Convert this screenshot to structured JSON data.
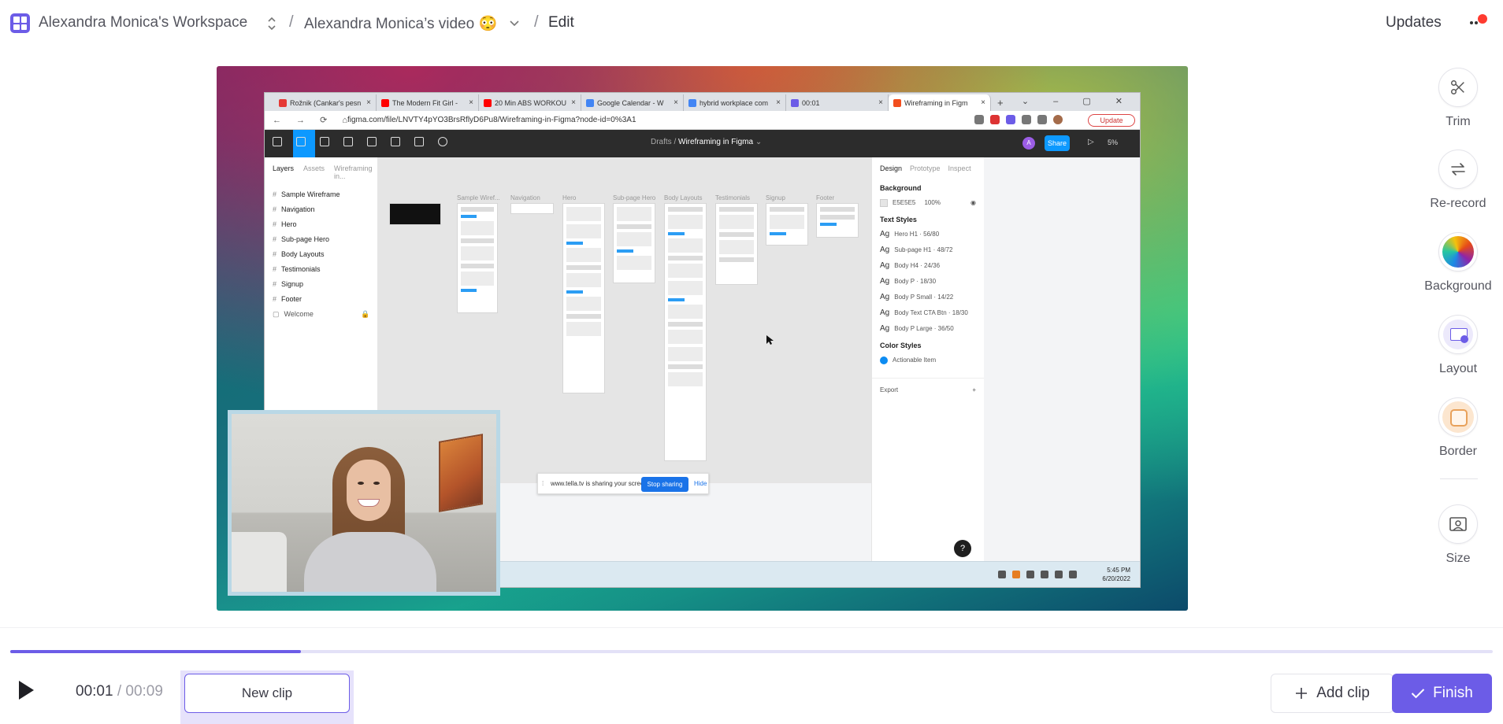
{
  "header": {
    "workspace_name": "Alexandra Monica's Workspace",
    "separator": "/",
    "video_name": "Alexandra Monica’s video 😳",
    "page": "Edit",
    "updates_label": "Updates"
  },
  "screen": {
    "browser_tabs": [
      {
        "label": "Rožnik (Cankar's pesn",
        "color": "#e53935"
      },
      {
        "label": "The Modern Fit Girl -",
        "color": "#ff0000"
      },
      {
        "label": "20 Min ABS WORKOU",
        "color": "#ff0000"
      },
      {
        "label": "Google Calendar - W",
        "color": "#4285f4"
      },
      {
        "label": "hybrid workplace com",
        "color": "#4285f4"
      },
      {
        "label": "00:01",
        "color": "#6c5ce7"
      },
      {
        "label": "Wireframing in Figm",
        "color": "#f24e1e"
      }
    ],
    "url": "figma.com/file/LNVTY4pYO3BrsRflyD6Pu8/Wireframing-in-Figma?node-id=0%3A1",
    "update_btn": "Update",
    "figma": {
      "breadcrumb_prefix": "Drafts /",
      "file_name": "Wireframing in Figma",
      "share_label": "Share",
      "avatar_letter": "A",
      "zoom": "5%",
      "layers_tabs": [
        "Layers",
        "Assets",
        "Wireframing in..."
      ],
      "layers": [
        "Sample Wireframe",
        "Navigation",
        "Hero",
        "Sub-page Hero",
        "Body Layouts",
        "Testimonials",
        "Signup",
        "Footer"
      ],
      "locked_layer": "Welcome",
      "frames": [
        "Sample Wiref...",
        "Navigation",
        "Hero",
        "Sub-page Hero",
        "Body Layouts",
        "Testimonials",
        "Signup",
        "Footer"
      ],
      "design_tabs": [
        "Design",
        "Prototype",
        "Inspect"
      ],
      "background_heading": "Background",
      "background_value": "E5E5E5",
      "background_opacity": "100%",
      "text_styles_heading": "Text Styles",
      "text_styles": [
        "Hero H1 · 56/80",
        "Sub-page H1 · 48/72",
        "Body H4 · 24/36",
        "Body P · 18/30",
        "Body P Small · 14/22",
        "Body Text CTA Btn · 18/30",
        "Body P Large · 36/50"
      ],
      "color_styles_heading": "Color Styles",
      "color_style": "Actionable Item",
      "export_label": "Export",
      "help": "?"
    },
    "share_notice": "www.tella.tv is sharing your screen.",
    "stop_sharing": "Stop sharing",
    "hide": "Hide",
    "clock_time": "5:45 PM",
    "clock_date": "6/20/2022"
  },
  "tools": [
    {
      "label": "Trim",
      "icon": "scissors-icon"
    },
    {
      "label": "Re-record",
      "icon": "re-record-icon"
    },
    {
      "label": "Background",
      "icon": "background-gradient-icon"
    },
    {
      "label": "Layout",
      "icon": "layout-icon"
    },
    {
      "label": "Border",
      "icon": "border-icon"
    },
    {
      "label": "Size",
      "icon": "size-icon"
    }
  ],
  "playback": {
    "current_time": "00:01",
    "total_time": "/ 00:09",
    "progress": 0.196
  },
  "actions": {
    "new_clip": "New clip",
    "add_clip": "Add clip",
    "finish": "Finish"
  },
  "colors": {
    "accent": "#6c5ce7",
    "accent_light": "#e6e2fb"
  }
}
